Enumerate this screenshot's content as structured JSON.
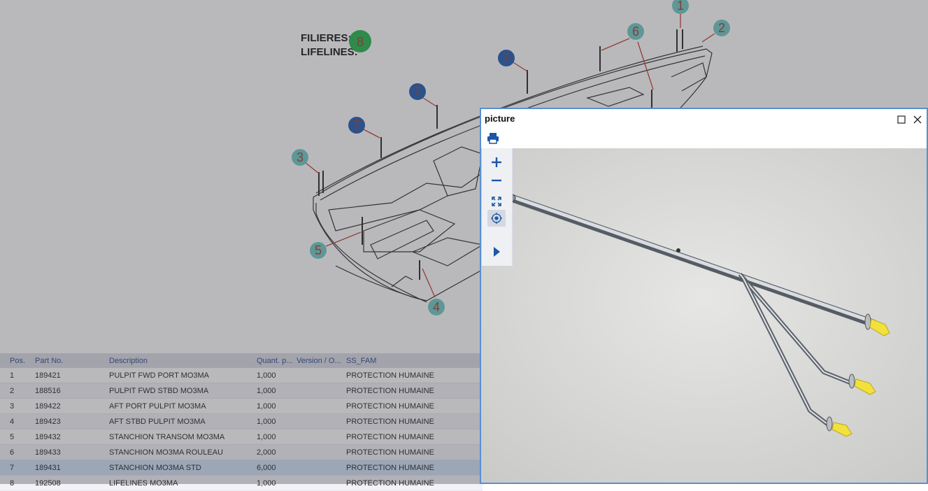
{
  "legend": {
    "line1": "FILIERES:",
    "line2": "LIFELINES:",
    "badge": "8"
  },
  "callouts": [
    "1",
    "2",
    "3",
    "4",
    "5",
    "6",
    "7",
    "8"
  ],
  "colors": {
    "callout_teal": "#6ec9c4",
    "callout_blue": "#1d58b0",
    "callout_green": "#22b34a",
    "callout_text": "#a23b2b",
    "window_border": "#5a8fd0",
    "selected_row": "#cfe0f5",
    "icon_blue": "#1a57a6"
  },
  "table": {
    "headers": {
      "pos": "Pos.",
      "part_no": "Part No.",
      "description": "Description",
      "quantity": "Quant. p...",
      "version": "Version / O...",
      "ss_fam": "SS_FAM"
    },
    "rows": [
      {
        "pos": "1",
        "part_no": "189421",
        "description": "PULPIT FWD PORT MO3MA",
        "quantity": "1,000",
        "version": "",
        "ss_fam": "PROTECTION HUMAINE"
      },
      {
        "pos": "2",
        "part_no": "188516",
        "description": "PULPIT FWD STBD MO3MA",
        "quantity": "1,000",
        "version": "",
        "ss_fam": "PROTECTION HUMAINE"
      },
      {
        "pos": "3",
        "part_no": "189422",
        "description": "AFT PORT PULPIT MO3MA",
        "quantity": "1,000",
        "version": "",
        "ss_fam": "PROTECTION HUMAINE"
      },
      {
        "pos": "4",
        "part_no": "189423",
        "description": "AFT STBD PULPIT MO3MA",
        "quantity": "1,000",
        "version": "",
        "ss_fam": "PROTECTION HUMAINE"
      },
      {
        "pos": "5",
        "part_no": "189432",
        "description": "STANCHION TRANSOM MO3MA",
        "quantity": "1,000",
        "version": "",
        "ss_fam": "PROTECTION HUMAINE"
      },
      {
        "pos": "6",
        "part_no": "189433",
        "description": "STANCHION MO3MA ROULEAU",
        "quantity": "2,000",
        "version": "",
        "ss_fam": "PROTECTION HUMAINE"
      },
      {
        "pos": "7",
        "part_no": "189431",
        "description": "STANCHION MO3MA STD",
        "quantity": "6,000",
        "version": "",
        "ss_fam": "PROTECTION HUMAINE",
        "selected": true
      },
      {
        "pos": "8",
        "part_no": "192508",
        "description": "LIFELINES MO3MA",
        "quantity": "1,000",
        "version": "",
        "ss_fam": "PROTECTION HUMAINE"
      }
    ]
  },
  "picture_window": {
    "title": "picture",
    "icons": [
      "print-icon",
      "maximize-icon",
      "close-icon",
      "zoom-in-icon",
      "zoom-out-icon",
      "fit-to-screen-icon",
      "center-icon",
      "play-icon"
    ]
  }
}
